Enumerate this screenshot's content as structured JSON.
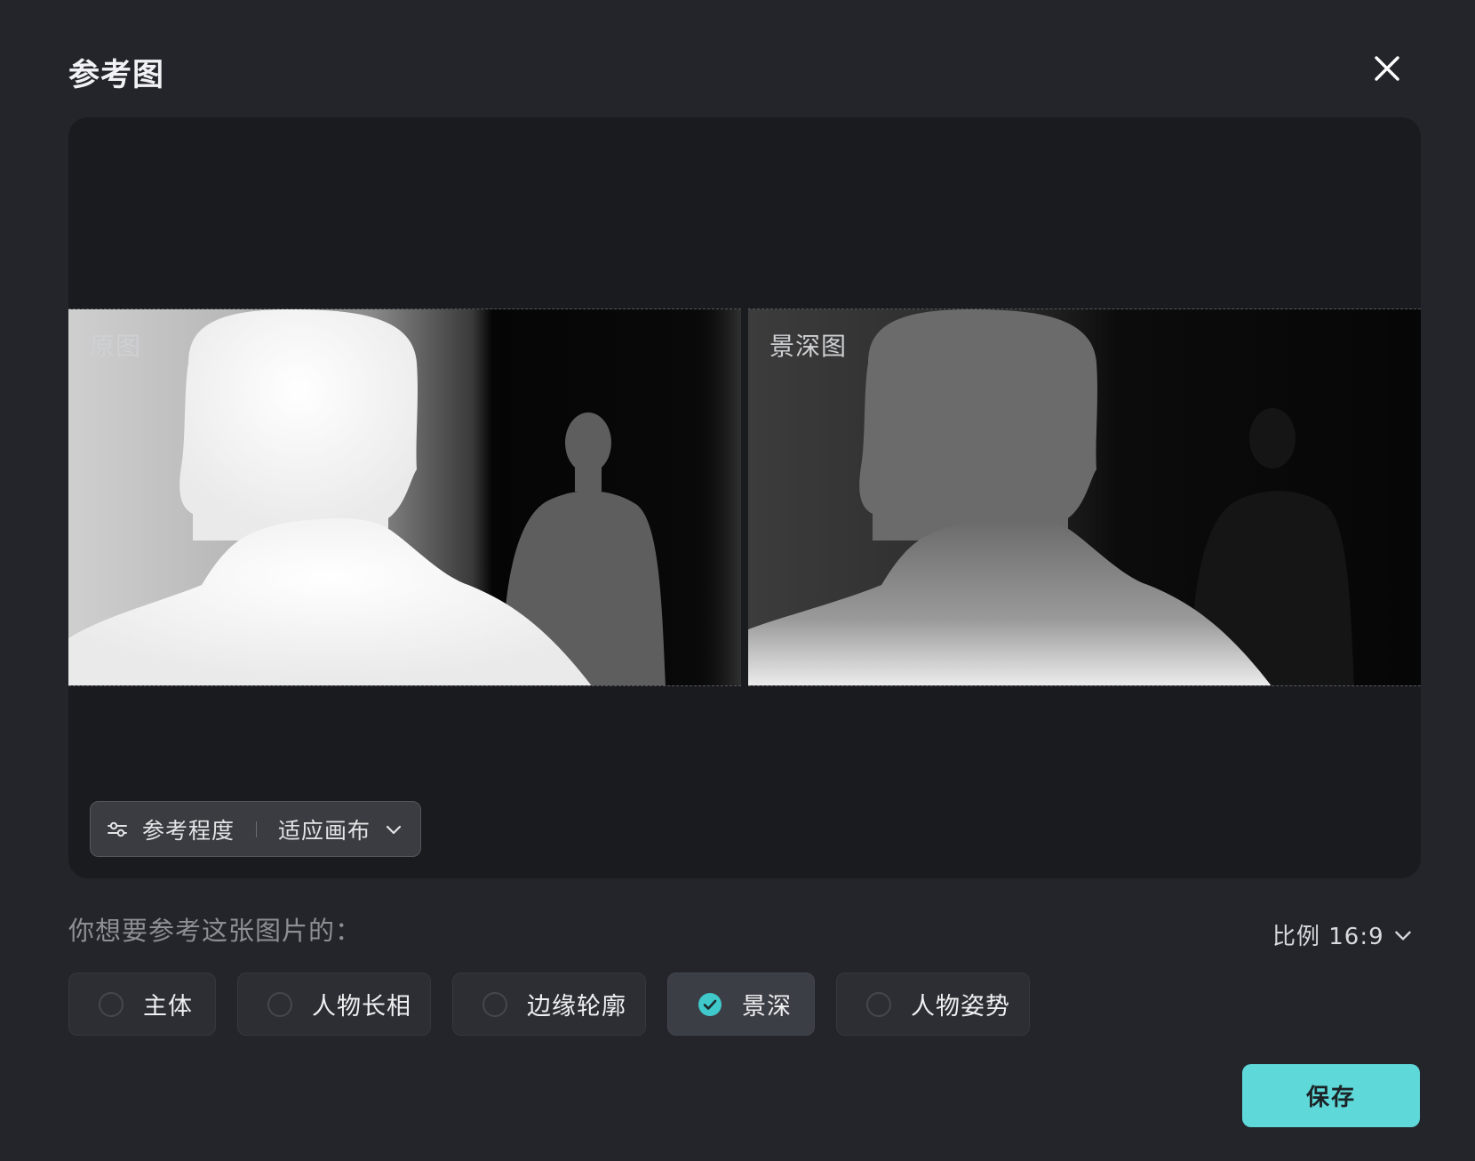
{
  "dialog": {
    "title": "参考图",
    "close_icon": "close-icon"
  },
  "preview": {
    "original_label": "原图",
    "depth_label": "景深图",
    "control": {
      "icon": "sliders-icon",
      "reference_label": "参考程度",
      "fit_label": "适应画布",
      "dropdown_icon": "chevron-down-icon"
    }
  },
  "question": "你想要参考这张图片的：",
  "ratio": {
    "label": "比例 16:9",
    "dropdown_icon": "chevron-down-icon"
  },
  "options": [
    {
      "label": "主体",
      "selected": false
    },
    {
      "label": "人物长相",
      "selected": false
    },
    {
      "label": "边缘轮廓",
      "selected": false
    },
    {
      "label": "景深",
      "selected": true
    },
    {
      "label": "人物姿势",
      "selected": false
    }
  ],
  "save_label": "保存",
  "colors": {
    "background": "#23252b",
    "preview_bg": "#1a1b1f",
    "accent": "#5fd8d9",
    "checked": "#3fc9cb"
  }
}
